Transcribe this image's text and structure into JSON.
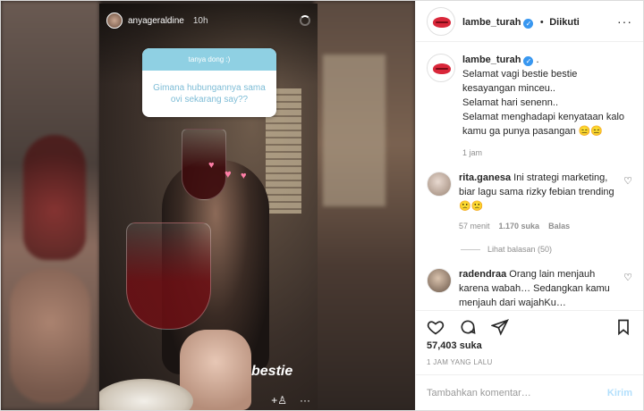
{
  "story": {
    "username": "anyageraldine",
    "time": "10h",
    "question_header": "tanya dong :)",
    "question_text": "Gimana hubungannya sama ovi sekarang say??",
    "sticker_text": "bestie"
  },
  "post": {
    "author": "lambe_turah",
    "separator": "•",
    "follow_state": "Diikuti",
    "caption_author": "lambe_turah",
    "caption_suffix": ".",
    "caption_lines": [
      "Selamat vagi bestie bestie kesayangan minceu..",
      "Selamat hari senenn..",
      "Selamat menghadapi kenyataan kalo kamu ga punya pasangan 😑😑"
    ],
    "caption_time": "1 jam",
    "comments": [
      {
        "user": "rita.ganesa",
        "text": "Ini strategi marketing, biar lagu sama rizky febian trending 🙁🙁",
        "time": "57 menit",
        "likes": "1.170 suka",
        "reply": "Balas",
        "view_replies": "Lihat balasan (50)"
      },
      {
        "user": "radendraa",
        "text": "Orang lain menjauh karena wabah… Sedangkan kamu menjauh dari wajahKu…"
      }
    ],
    "likes": "57,403 suka",
    "posted_ago": "1 JAM YANG LALU",
    "comment_placeholder": "Tambahkan komentar…",
    "post_button": "Kirim"
  },
  "colors": {
    "accent": "#3897f0",
    "post_button": "#b2dffc",
    "question_header_bg": "#8fd0e3",
    "heart_pink": "#ff7fa8"
  },
  "icons": [
    "more-icon",
    "verified-icon",
    "heart-icon",
    "comment-icon",
    "share-icon",
    "bookmark-icon",
    "add-person-icon",
    "more-horizontal-icon",
    "loader-icon"
  ]
}
